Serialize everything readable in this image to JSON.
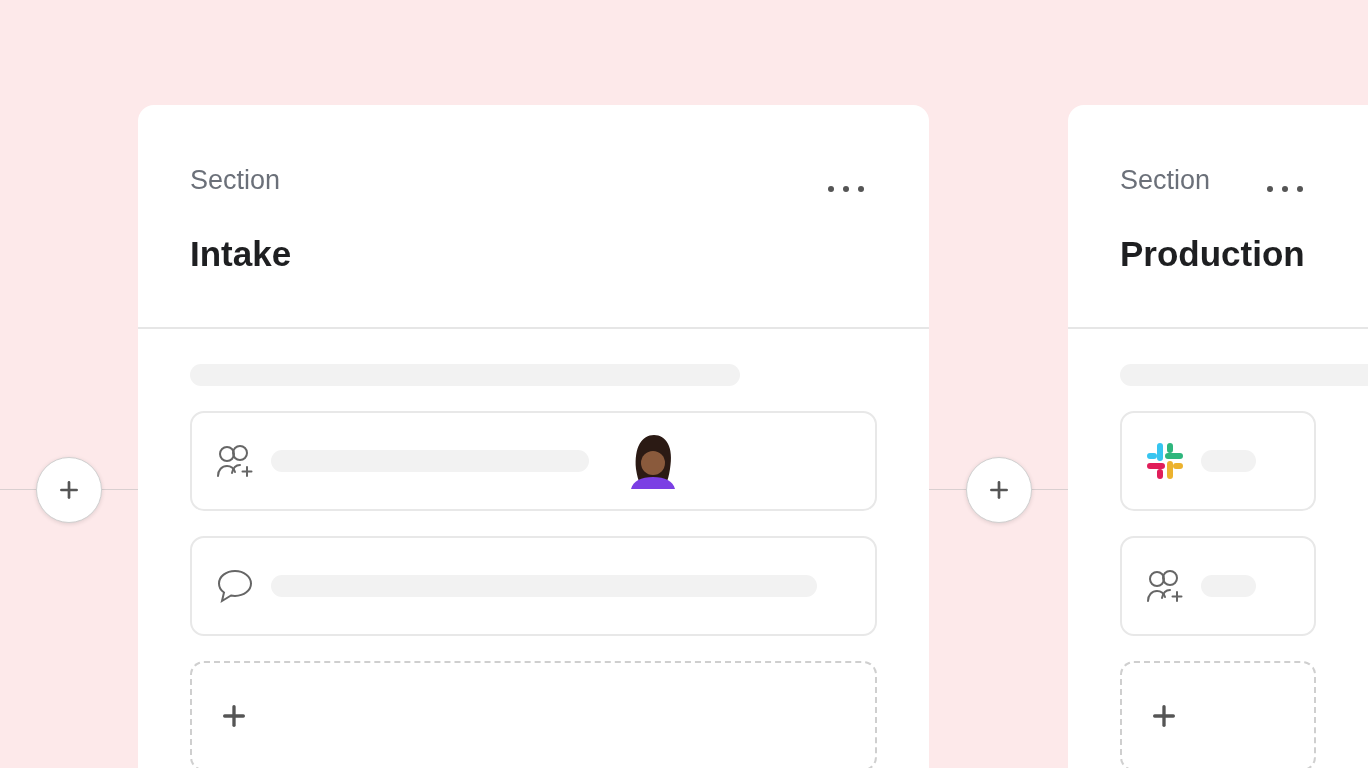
{
  "sections": [
    {
      "label": "Section",
      "title": "Intake",
      "rows": [
        {
          "kind": "people",
          "assignee": true
        },
        {
          "kind": "chat",
          "assignee": false
        }
      ]
    },
    {
      "label": "Section",
      "title": "Production",
      "rows": [
        {
          "kind": "app"
        },
        {
          "kind": "people"
        }
      ]
    }
  ]
}
